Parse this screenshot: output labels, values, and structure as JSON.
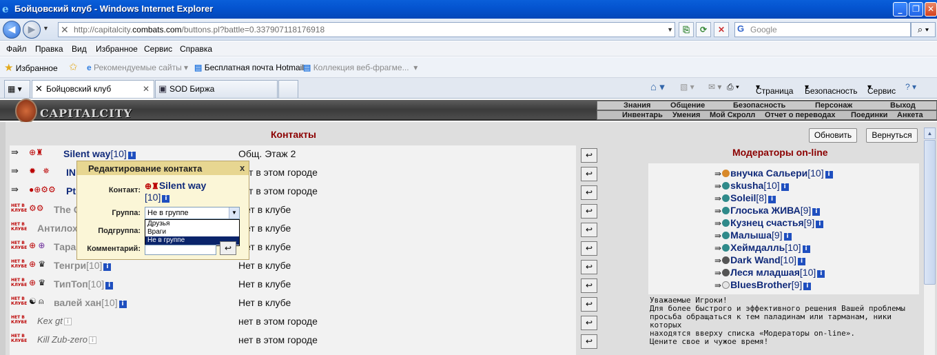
{
  "window": {
    "title": "Бойцовский клуб - Windows Internet Explorer"
  },
  "address": {
    "prefix": "http://capitalcity.",
    "host": "combats.com",
    "path": "/buttons.pl?battle=0.337907118176918",
    "search_placeholder": "Google"
  },
  "menu": [
    "Файл",
    "Правка",
    "Вид",
    "Избранное",
    "Сервис",
    "Справка"
  ],
  "favorites": {
    "label": "Избранное",
    "items": [
      "Рекомендуемые сайты",
      "Бесплатная почта Hotmail",
      "Коллекция веб-фрагме..."
    ]
  },
  "tabs": [
    "Бойцовский клуб",
    "SOD Биржа"
  ],
  "commandbar": {
    "page": "Страница",
    "safety": "Безопасность",
    "tools": "Сервис"
  },
  "game_header": {
    "site_name": "CAPITALCITY",
    "menu_top": [
      "Знания",
      "Общение",
      "Безопасность",
      "Персонаж",
      "Выход"
    ],
    "menu_bottom": [
      "Инвентарь",
      "Умения",
      "Мой Скролл",
      "Отчет о переводах",
      "Поединки",
      "Анкета"
    ]
  },
  "contacts": {
    "title": "Контакты",
    "refresh_button": "Обновить",
    "back_button": "Вернуться",
    "rows": [
      {
        "nick": "Silent way",
        "level": "[10]",
        "location": "Общ. Этаж 2"
      },
      {
        "nick": "IN",
        "level": "",
        "location": "нет в этом городе"
      },
      {
        "nick": "Pt",
        "level": "",
        "location": "нет в этом городе"
      },
      {
        "nick": "The C",
        "level": "",
        "location": "Нет в клубе"
      },
      {
        "nick": "Антилох",
        "level": "",
        "location": "Нет в клубе"
      },
      {
        "nick": "Тара",
        "level": "",
        "location": "Нет в клубе"
      },
      {
        "nick": "Тенгри",
        "level": "[10]",
        "location": "Нет в клубе"
      },
      {
        "nick": "ТипТоп",
        "level": "[10]",
        "location": "Нет в клубе"
      },
      {
        "nick": "валей хан",
        "level": "[10]",
        "location": "Нет в клубе"
      },
      {
        "nick": "Kex gt",
        "level": "",
        "location": "нет в этом городе"
      },
      {
        "nick": "Kill Zub-zero",
        "level": "",
        "location": "нет в этом городе"
      }
    ],
    "offline_badge": "НЕТ В КЛУБЕ"
  },
  "moderators": {
    "title": "Модераторы on-line",
    "rows": [
      {
        "nick": "внучка Сальери",
        "level": "[10]"
      },
      {
        "nick": "skusha",
        "level": "[10]"
      },
      {
        "nick": "Soleil",
        "level": "[8]"
      },
      {
        "nick": "Глоська ЖИВА",
        "level": "[9]"
      },
      {
        "nick": "Кузнец счастья",
        "level": "[9]"
      },
      {
        "nick": "Малыша",
        "level": "[9]"
      },
      {
        "nick": "Хеймдалль",
        "level": "[10]"
      },
      {
        "nick": "Dark Wand",
        "level": "[10]"
      },
      {
        "nick": "Леся младшая",
        "level": "[10]"
      },
      {
        "nick": "BluesBrother",
        "level": "[9]"
      }
    ],
    "notice": [
      "Уважаемые Игроки!",
      "Для более быстрого и эффективного решения Вашей проблемы",
      "просьба обращаться к тем паладинам или тарманам, ники которых",
      "находятся вверху списка «Модераторы on-line».",
      "Цените свое и чужое время!"
    ]
  },
  "dialog": {
    "title": "Редактирование контакта",
    "close": "x",
    "contact_label": "Контакт:",
    "contact_nick": "Silent way",
    "contact_level": "[10]",
    "group_label": "Группа:",
    "group_value": "Не в группе",
    "group_options": [
      "Друзья",
      "Враги",
      "Не в группе"
    ],
    "subgroup_label": "Подгруппа:",
    "comment_label": "Комментарий:"
  }
}
